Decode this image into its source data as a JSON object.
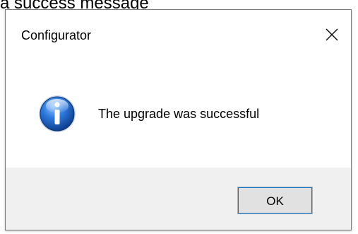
{
  "caption": "a success message",
  "dialog": {
    "title": "Configurator",
    "close_icon": "close-icon",
    "message": "The upgrade was successful",
    "message_icon": "info-icon",
    "ok_label": "OK"
  },
  "colors": {
    "footer_background": "#f0f0f0",
    "button_background": "#e1e1e1",
    "button_focus": "#0078d7",
    "icon_blue": "#1c5fb8"
  }
}
